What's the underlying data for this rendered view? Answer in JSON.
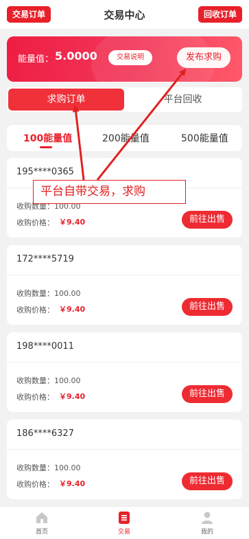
{
  "header": {
    "left_button": "交易订单",
    "title": "交易中心",
    "right_button": "回收订单"
  },
  "banner": {
    "energy_label": "能量值：",
    "energy_value": "5.0000",
    "explain_button": "交易说明",
    "publish_button": "发布求购"
  },
  "segments": {
    "active": "求购订单",
    "inactive": "平台回收"
  },
  "value_tabs": [
    "100能量值",
    "200能量值",
    "500能量值"
  ],
  "orders": [
    {
      "phone": "195****0365",
      "qty_label": "收购数量：",
      "qty": "100.00",
      "price_label": "收购价格：",
      "price": "￥9.40",
      "button": "前往出售"
    },
    {
      "phone": "172****5719",
      "qty_label": "收购数量：",
      "qty": "100.00",
      "price_label": "收购价格：",
      "price": "￥9.40",
      "button": "前往出售"
    },
    {
      "phone": "198****0011",
      "qty_label": "收购数量：",
      "qty": "100.00",
      "price_label": "收购价格：",
      "price": "￥9.40",
      "button": "前往出售"
    },
    {
      "phone": "186****6327",
      "qty_label": "收购数量：",
      "qty": "100.00",
      "price_label": "收购价格：",
      "price": "￥9.40",
      "button": "前往出售"
    }
  ],
  "annotation": "平台自带交易，求购",
  "bottom_nav": [
    {
      "label": "首页",
      "icon": "home-icon"
    },
    {
      "label": "交易",
      "icon": "trade-icon"
    },
    {
      "label": "我的",
      "icon": "user-icon"
    }
  ],
  "colors": {
    "accent": "#e8202a",
    "background": "#f2f2f2"
  }
}
